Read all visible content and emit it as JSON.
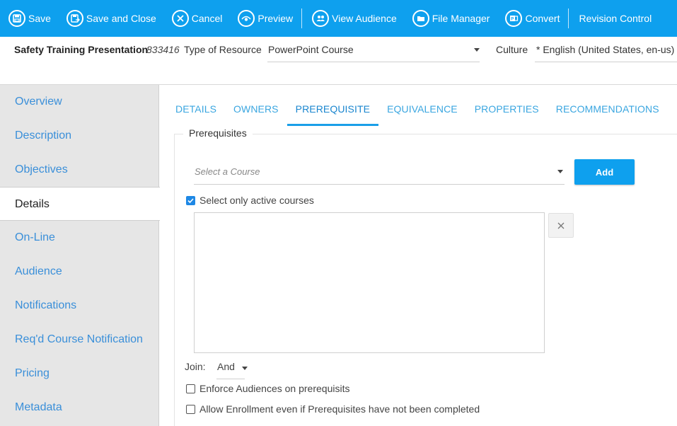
{
  "toolbar": {
    "save": "Save",
    "save_close": "Save and Close",
    "cancel": "Cancel",
    "preview": "Preview",
    "view_audience": "View Audience",
    "file_manager": "File Manager",
    "convert": "Convert",
    "revision_control": "Revision Control"
  },
  "info": {
    "course_title": "Safety Training Presentation",
    "course_id": "833416",
    "type_label": "Type of Resource",
    "type_value": "PowerPoint Course",
    "culture_label": "Culture",
    "culture_value": "* English (United States, en-us)"
  },
  "sidebar": {
    "items": [
      {
        "label": "Overview"
      },
      {
        "label": "Description"
      },
      {
        "label": "Objectives"
      },
      {
        "label": "Details"
      },
      {
        "label": "On-Line"
      },
      {
        "label": "Audience"
      },
      {
        "label": "Notifications"
      },
      {
        "label": "Req'd Course Notification"
      },
      {
        "label": "Pricing"
      },
      {
        "label": "Metadata"
      }
    ]
  },
  "tabs": [
    {
      "label": "DETAILS"
    },
    {
      "label": "OWNERS"
    },
    {
      "label": "PREREQUISITE"
    },
    {
      "label": "EQUIVALENCE"
    },
    {
      "label": "PROPERTIES"
    },
    {
      "label": "RECOMMENDATIONS"
    }
  ],
  "prereq": {
    "legend": "Prerequisites",
    "course_placeholder": "Select a Course",
    "add_label": "Add",
    "active_only_label": "Select only active courses",
    "active_only_checked": true,
    "join_label": "Join:",
    "join_value": "And",
    "enforce_label": "Enforce Audiences on prerequisits",
    "enforce_checked": false,
    "allow_label": "Allow Enrollment even if Prerequisites have not been completed",
    "allow_checked": false
  },
  "colors": {
    "toolbar_bg": "#0ea0ee",
    "accent": "#1a9fe8",
    "link": "#3a8fd9"
  }
}
